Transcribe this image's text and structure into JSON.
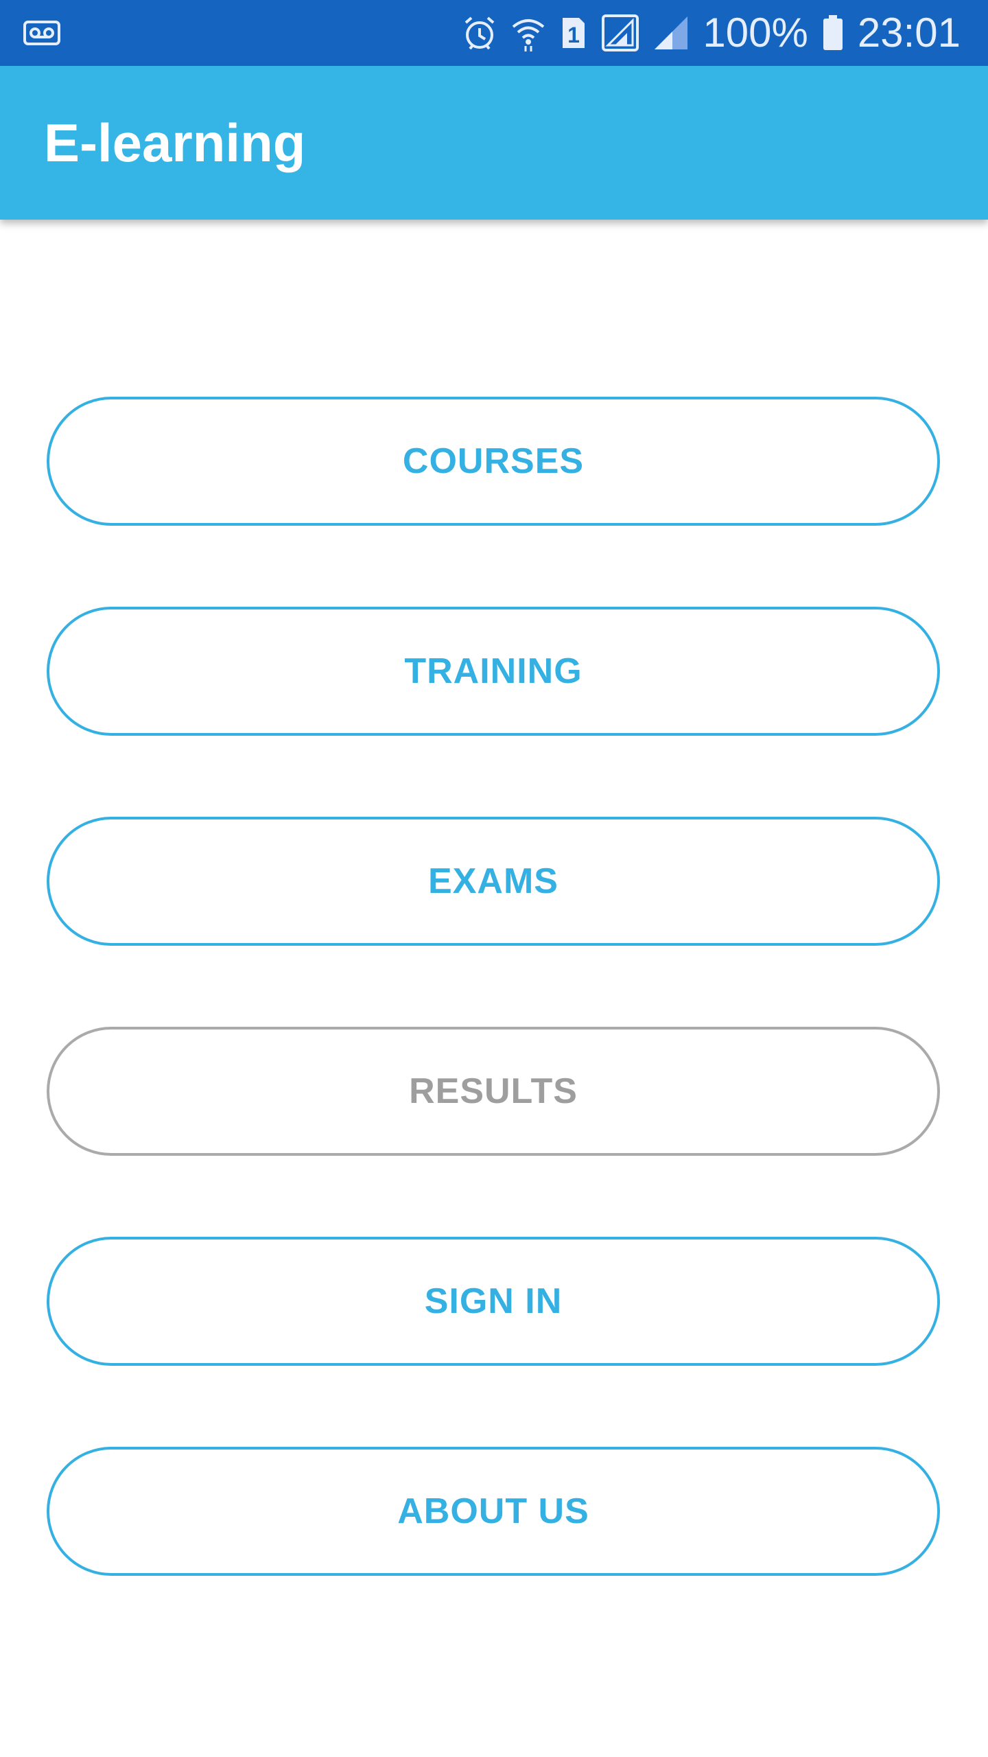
{
  "status_bar": {
    "battery_percent": "100%",
    "time": "23:01",
    "icons": [
      "voicemail-icon",
      "alarm-icon",
      "wifi-icon",
      "sim-1-icon",
      "signal-icon",
      "signal-icon",
      "battery-icon"
    ],
    "sim_badge": "1"
  },
  "app_bar": {
    "title": "E-learning",
    "color": "#35b5e5"
  },
  "menu": {
    "accent_color": "#35b0e2",
    "disabled_color": "#9e9e9e",
    "items": [
      {
        "label": "COURSES",
        "enabled": true
      },
      {
        "label": "TRAINING",
        "enabled": true
      },
      {
        "label": "EXAMS",
        "enabled": true
      },
      {
        "label": "RESULTS",
        "enabled": false
      },
      {
        "label": "SIGN IN",
        "enabled": true
      },
      {
        "label": "ABOUT US",
        "enabled": true
      }
    ]
  }
}
